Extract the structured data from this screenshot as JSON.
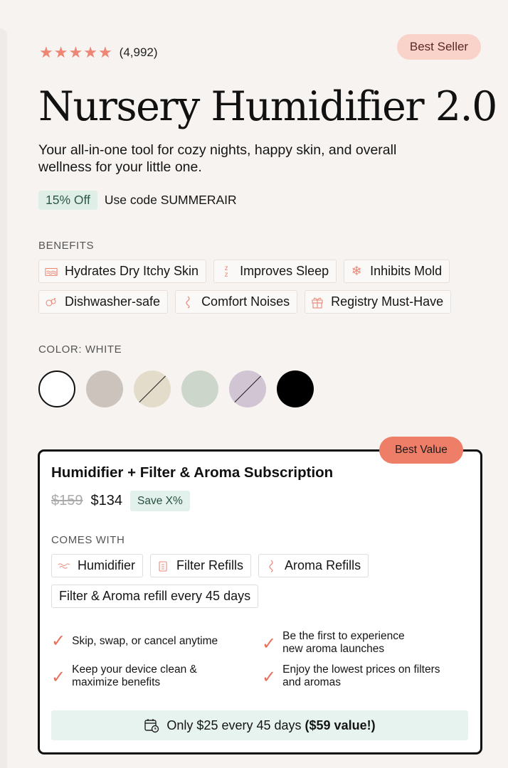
{
  "rating": {
    "stars": 5,
    "count_text": "(4,992)"
  },
  "badge_best_seller": "Best Seller",
  "product": {
    "title": "Nursery Humidifier 2.0",
    "subtitle": "Your all-in-one tool for cozy nights, happy skin, and overall wellness for your little one."
  },
  "promo": {
    "badge": "15% Off",
    "text": "Use code SUMMERAIR"
  },
  "benefits": {
    "label": "BENEFITS",
    "row1": [
      {
        "icon": "waves-icon",
        "label": "Hydrates Dry Itchy Skin"
      },
      {
        "icon": "sleep-icon",
        "label": "Improves Sleep"
      },
      {
        "icon": "snowflake-icon",
        "label": "Inhibits Mold"
      }
    ],
    "row2": [
      {
        "icon": "dishwasher-icon",
        "label": "Dishwasher-safe"
      },
      {
        "icon": "sound-icon",
        "label": "Comfort Noises"
      },
      {
        "icon": "gift-icon",
        "label": "Registry Must-Have"
      }
    ]
  },
  "color": {
    "label": "COLOR: WHITE",
    "swatches": [
      {
        "name": "white",
        "hex": "#ffffff",
        "selected": true,
        "unavailable": false
      },
      {
        "name": "taupe",
        "hex": "#cbc3bc",
        "selected": false,
        "unavailable": false
      },
      {
        "name": "cream",
        "hex": "#e4dccb",
        "selected": false,
        "unavailable": true
      },
      {
        "name": "sage",
        "hex": "#cdd6ca",
        "selected": false,
        "unavailable": false
      },
      {
        "name": "lavender",
        "hex": "#d2c5d3",
        "selected": false,
        "unavailable": true
      },
      {
        "name": "black",
        "hex": "#000000",
        "selected": false,
        "unavailable": false
      }
    ]
  },
  "offer": {
    "badge": "Best Value",
    "title": "Humidifier + Filter & Aroma Subscription",
    "old_price": "$159",
    "price": "$134",
    "save_badge": "Save X%",
    "comes_with_label": "COMES WITH",
    "items": [
      {
        "icon": "humidifier-icon",
        "label": "Humidifier"
      },
      {
        "icon": "filter-icon",
        "label": "Filter Refills"
      },
      {
        "icon": "aroma-icon",
        "label": "Aroma Refills"
      }
    ],
    "refill_note": "Filter & Aroma refill every 45 days",
    "perks": [
      "Skip, swap, or cancel anytime",
      "Be the first to experience\nnew aroma launches",
      "Keep your device clean &\nmaximize benefits",
      "Enjoy the lowest prices on filters\nand aromas"
    ],
    "footer_text": "Only $25 every 45 days",
    "footer_value": "($59 value!)"
  },
  "colors": {
    "accent": "#ef7e68",
    "star": "#ee8676",
    "mint": "#e7f3ee"
  }
}
